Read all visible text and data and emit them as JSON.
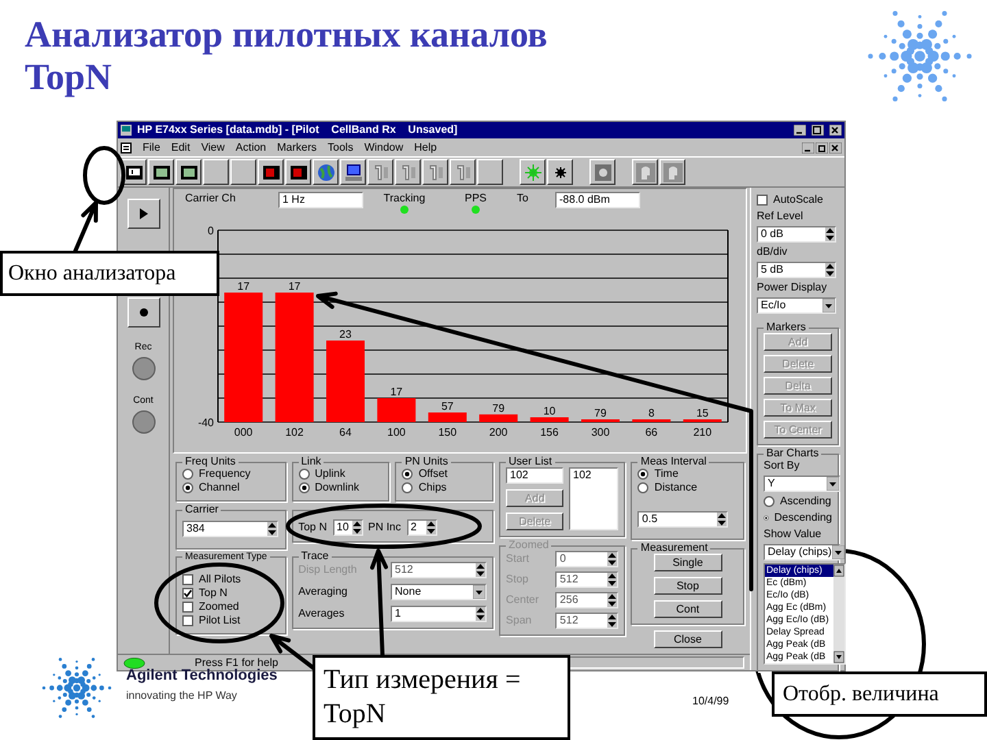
{
  "slide": {
    "title": "Анализатор пилотных каналов TopN",
    "company": "Agilent Technologies",
    "tagline": "innovating the HP Way",
    "date": "10/4/99"
  },
  "window": {
    "title": "HP E74xx Series [data.mdb] - [Pilot    CellBand Rx    Unsaved]"
  },
  "menu": [
    "File",
    "Edit",
    "View",
    "Action",
    "Markers",
    "Tools",
    "Window",
    "Help"
  ],
  "transport": {
    "labels": [
      "Rec",
      "Cont"
    ]
  },
  "header": {
    "carrier_label": "Carrier Ch",
    "carrier_value": "1 Hz",
    "tracking_label": "Tracking",
    "tracking_on": true,
    "pps_label": "PPS",
    "pps_on": true,
    "to_label": "To",
    "to_value": "-88.0 dBm"
  },
  "bar_chart": {
    "y_axis_labels": [
      "0",
      "-40"
    ],
    "categories": [
      "000",
      "102",
      "64",
      "100",
      "150",
      "200",
      "156",
      "300",
      "66",
      "210"
    ],
    "readings": [
      "17",
      "17",
      "23",
      "17",
      "57",
      "79",
      "10",
      "79",
      "8",
      "15"
    ]
  },
  "freq_units": {
    "title": "Freq Units",
    "options": [
      {
        "label": "Frequency",
        "selected": false
      },
      {
        "label": "Channel",
        "selected": true
      }
    ]
  },
  "link": {
    "title": "Link",
    "options": [
      {
        "label": "Uplink",
        "selected": false
      },
      {
        "label": "Downlink",
        "selected": true
      }
    ]
  },
  "pn_units": {
    "title": "PN Units",
    "options": [
      {
        "label": "Offset",
        "selected": true
      },
      {
        "label": "Chips",
        "selected": false
      }
    ]
  },
  "carrier": {
    "title": "Carrier",
    "value": "384"
  },
  "limit": {
    "fields": [
      {
        "label": "Top N",
        "value": "10"
      },
      {
        "label": "PN Inc",
        "value": "2"
      }
    ]
  },
  "measurement_type": {
    "title": "Measurement Type",
    "options": [
      {
        "label": "All Pilots",
        "checked": false
      },
      {
        "label": "Top N",
        "checked": true
      },
      {
        "label": "Zoomed",
        "checked": false
      },
      {
        "label": "Pilot List",
        "checked": false
      }
    ]
  },
  "trace": {
    "title": "Trace",
    "fields": [
      {
        "label": "Disp Length",
        "value": "512",
        "kind": "spin",
        "disabled": true
      },
      {
        "label": "Averaging",
        "value": "None",
        "kind": "dropdown",
        "disabled": false
      },
      {
        "label": "Averages",
        "value": "1",
        "kind": "spin",
        "disabled": false
      }
    ]
  },
  "user_list": {
    "title": "User List",
    "value": "102",
    "items": [
      "102"
    ],
    "buttons": [
      {
        "label": "Add",
        "disabled": true
      },
      {
        "label": "Delete",
        "disabled": true
      }
    ]
  },
  "zoomed": {
    "title": "Zoomed",
    "disabled": true,
    "fields": [
      {
        "label": "Start",
        "value": "0"
      },
      {
        "label": "Stop",
        "value": "512"
      },
      {
        "label": "Center",
        "value": "256"
      },
      {
        "label": "Span",
        "value": "512"
      }
    ]
  },
  "meas_interval": {
    "title": "Meas Interval",
    "options": [
      {
        "label": "Time",
        "selected": true
      },
      {
        "label": "Distance",
        "selected": false
      }
    ],
    "value": "0.5"
  },
  "measurement": {
    "title": "Measurement",
    "buttons": [
      "Single",
      "Stop",
      "Cont"
    ]
  },
  "close_button": "Close",
  "status_bar": "Press F1 for help",
  "scale": {
    "autoscale": {
      "label": "AutoScale",
      "checked": false
    },
    "fields": [
      {
        "label": "Ref Level",
        "value": "0 dB",
        "kind": "spin"
      },
      {
        "label": "dB/div",
        "value": "5 dB",
        "kind": "spin"
      },
      {
        "label": "Power Display",
        "value": "Ec/Io",
        "kind": "dropdown"
      }
    ]
  },
  "markers": {
    "title": "Markers",
    "buttons": [
      {
        "label": "Add",
        "disabled": true
      },
      {
        "label": "Delete",
        "disabled": true
      },
      {
        "label": "Delta",
        "disabled": true
      },
      {
        "label": "To Max",
        "disabled": true
      },
      {
        "label": "To Center",
        "disabled": true
      }
    ]
  },
  "bar_charts": {
    "title": "Bar Charts",
    "sort_label": "Sort By",
    "sort_value": "Y",
    "order": [
      {
        "label": "Ascending",
        "selected": false
      },
      {
        "label": "Descending",
        "selected": true
      }
    ],
    "value_label": "Show Value",
    "value": "Delay (chips)",
    "list": [
      {
        "label": "Delay (chips)",
        "selected": true
      },
      {
        "label": "Ec (dBm)",
        "selected": false
      },
      {
        "label": "Ec/Io (dB)",
        "selected": false
      },
      {
        "label": "Agg Ec (dBm)",
        "selected": false
      },
      {
        "label": "Agg Ec/Io (dB)",
        "selected": false
      },
      {
        "label": "Delay Spread",
        "selected": false
      },
      {
        "label": "Agg Peak (dB",
        "selected": false
      },
      {
        "label": "Agg Peak (dB",
        "selected": false
      }
    ]
  },
  "callouts": [
    "Окно анализатора",
    "Тип измерения = TopN",
    "Отобр. величина"
  ]
}
